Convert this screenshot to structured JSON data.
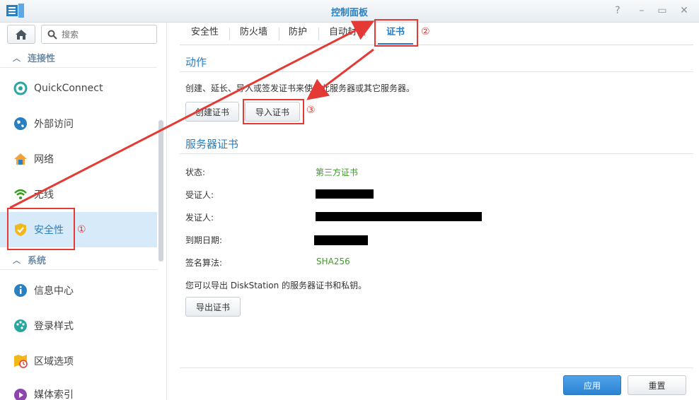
{
  "window": {
    "title": "控制面板",
    "controls": {
      "help": "?",
      "minimize": "–",
      "maximize": "▭",
      "close": "✕"
    }
  },
  "sidebar": {
    "search_placeholder": "搜索",
    "groups": [
      {
        "label": "连接性"
      },
      {
        "label": "系统"
      }
    ],
    "items": [
      {
        "label": "QuickConnect",
        "icon": "quickconnect-icon"
      },
      {
        "label": "外部访问",
        "icon": "globe-icon"
      },
      {
        "label": "网络",
        "icon": "network-house-icon"
      },
      {
        "label": "无线",
        "icon": "wifi-icon"
      },
      {
        "label": "安全性",
        "icon": "shield-icon",
        "active": true
      },
      {
        "label": "信息中心",
        "icon": "info-icon"
      },
      {
        "label": "登录样式",
        "icon": "palette-icon"
      },
      {
        "label": "区域选项",
        "icon": "map-clock-icon"
      },
      {
        "label": "媒体索引",
        "icon": "media-index-icon"
      }
    ]
  },
  "tabs": [
    {
      "label": "安全性"
    },
    {
      "label": "防火墙"
    },
    {
      "label": "防护"
    },
    {
      "label": "自动封锁"
    },
    {
      "label": "证书",
      "active": true
    }
  ],
  "actions": {
    "title": "动作",
    "description": "创建、延长、导入或签发证书来使用此服务器或其它服务器。",
    "create_button": "创建证书",
    "import_button": "导入证书"
  },
  "server_cert": {
    "title": "服务器证书",
    "rows": [
      {
        "label": "状态:",
        "value": "第三方证书"
      },
      {
        "label": "受证人:",
        "value": ""
      },
      {
        "label": "发证人:",
        "value": ""
      },
      {
        "label": "到期日期:",
        "value": ""
      },
      {
        "label": "签名算法:",
        "value": "SHA256"
      }
    ],
    "export_note": "您可以导出 DiskStation 的服务器证书和私钥。",
    "export_button": "导出证书"
  },
  "footer": {
    "apply_button": "应用",
    "reset_button": "重置"
  },
  "annotations": {
    "markers": [
      "①",
      "②",
      "③"
    ],
    "color": "#e53935"
  },
  "colors": {
    "accent": "#2a7fc0",
    "active_bg": "#d7eaf9",
    "value_green": "#3a9d23",
    "primary_button": "#2c83d2"
  }
}
